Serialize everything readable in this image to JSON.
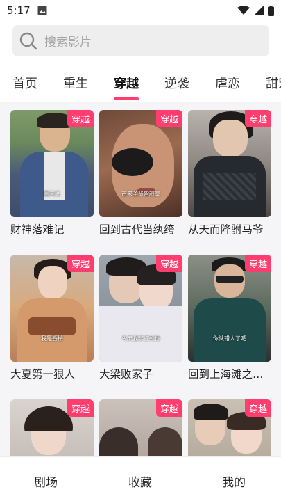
{
  "status": {
    "time": "5:17"
  },
  "search": {
    "placeholder": "搜索影片"
  },
  "tabs": [
    "首页",
    "重生",
    "穿越",
    "逆袭",
    "虐恋",
    "甜宠"
  ],
  "badge_label": "穿越",
  "cards": [
    {
      "title": "财神落难记",
      "caption": "回天庭"
    },
    {
      "title": "回到古代当纨绔",
      "caption": "古来圣贤皆寂寞"
    },
    {
      "title": "从天而降驸马爷",
      "caption": ""
    },
    {
      "title": "大夏第一狠人",
      "caption": "我是香楼"
    },
    {
      "title": "大梁败家子",
      "caption": "今天我非打死你"
    },
    {
      "title": "回到上海滩之…",
      "caption": "你认错人了吧"
    },
    {
      "title": "",
      "caption": ""
    },
    {
      "title": "",
      "caption": ""
    },
    {
      "title": "",
      "caption": ""
    }
  ],
  "bottom_nav": [
    "剧场",
    "收藏",
    "我的"
  ],
  "colors": {
    "accent": "#ff3d6e"
  }
}
